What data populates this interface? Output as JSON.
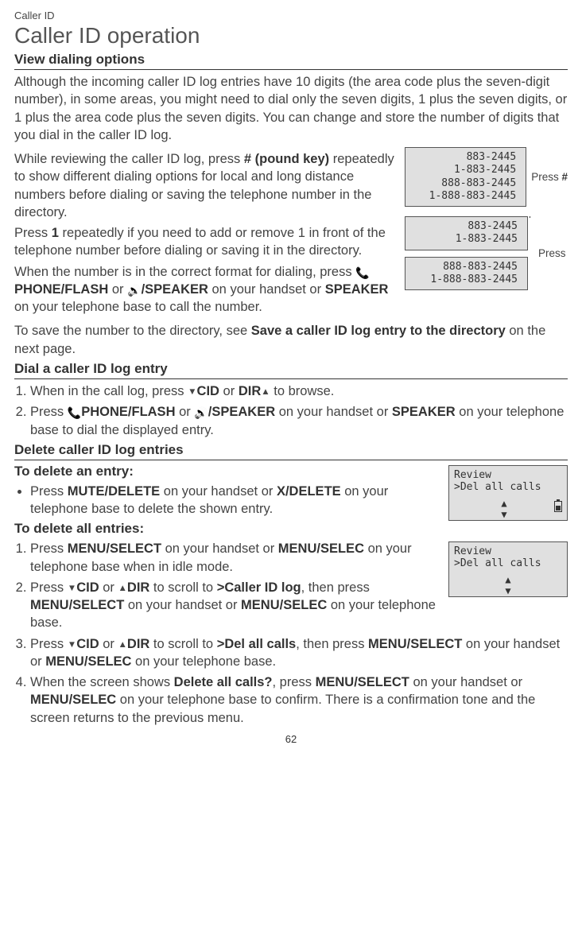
{
  "breadcrumb": "Caller ID",
  "title": "Caller ID operation",
  "section1": {
    "heading": "View dialing options",
    "p1a": "Although the incoming caller ID log entries have 10 digits (the area code plus the seven-digit number), in some areas, you might need to dial only the seven digits, 1 plus the seven digits, or 1 plus the area code plus the seven digits. You can change and store the number of digits that you dial in the caller ID log.",
    "p2a": "While reviewing the caller ID log, press ",
    "p2b": "# (pound key)",
    "p2c": " repeatedly to show different dialing options for local and long distance numbers before dialing or saving the telephone number in the directory.",
    "p3a": "Press ",
    "p3b": "1",
    "p3c": " repeatedly if you need to add or remove 1 in front of the telephone number before dialing or saving it in the directory.",
    "p4a": "When the number is in the correct format for dialing, press ",
    "p4b": "PHONE/",
    "p4b2": "FLASH",
    "p4c": " or ",
    "p4d": "/SPEAKER",
    "p4e": " on your handset or ",
    "p4f": "SPEAKER",
    "p4g": " on your telephone base to call the number.",
    "p5a": "To save the number to the directory, see ",
    "p5b": "Save a caller ID log entry to the directory",
    "p5c": " on the next page."
  },
  "fig": {
    "lcd1_lines": [
      "883-2445",
      "1-883-2445",
      "888-883-2445",
      "1-888-883-2445"
    ],
    "lcd2_lines": [
      "883-2445",
      "1-883-2445"
    ],
    "lcd3_lines": [
      "888-883-2445",
      "1-888-883-2445"
    ],
    "label_pound_a": "Press ",
    "label_pound_b": "#",
    "label_one_a": "Press ",
    "label_one_b": "1"
  },
  "section2": {
    "heading": "Dial a caller ID log entry",
    "s1a": "When in the call log, press ",
    "s1b": "CID",
    "s1c": " or ",
    "s1d": "DIR",
    "s1e": " to browse.",
    "s2a": "Press ",
    "s2b": "PHONE/",
    "s2b2": "FLASH",
    "s2c": " or ",
    "s2d": "/SPEAKER",
    "s2e": " on your handset or ",
    "s2f": "SPEAKER",
    "s2g": " on your telephone base to dial the displayed entry."
  },
  "section3": {
    "heading": "Delete caller ID log entries",
    "sub1": "To delete an entry:",
    "b1a": "Press ",
    "b1b": "MUTE",
    "b1c": "/DELETE",
    "b1d": " on your handset or ",
    "b1e": "X/DELETE",
    "b1f": " on your telephone base to delete the shown entry.",
    "sub2": "To delete all entries:",
    "s1a": "Press ",
    "s1b": "MENU/",
    "s1b2": "SELECT",
    "s1c": " on your handset or ",
    "s1d": "MENU/",
    "s1d2": "SELEC",
    "s1e": " on your telephone base when in idle mode.",
    "s2a": "Press ",
    "s2b": "CID",
    "s2c": " or ",
    "s2d": "DIR",
    "s2e": " to scroll to ",
    "s2f": ">Caller ID log",
    "s2g": ", then press ",
    "s2h": "MENU",
    "s2h2": "/SELECT",
    "s2i": " on your handset or ",
    "s2j": "MENU",
    "s2j2": "/SELEC",
    "s2k": " on your telephone base.",
    "s3a": "Press ",
    "s3b": "CID",
    "s3c": " or ",
    "s3d": "DIR",
    "s3e": " to scroll to ",
    "s3f": ">Del all calls",
    "s3g": ", then press ",
    "s3h": "MENU",
    "s3h2": "/SELECT",
    "s3i": " on your handset or ",
    "s3j": "MENU",
    "s3j2": "/SELEC",
    "s3k": " on your telephone base.",
    "s4a": "When the screen shows ",
    "s4b": "Delete all calls?",
    "s4c": ", press ",
    "s4d": "MENU",
    "s4d2": "/SELECT",
    "s4e": " on your handset or ",
    "s4f": "MENU",
    "s4f2": "/SELEC",
    "s4g": " on your telephone base to confirm. There is a confirmation tone and the screen returns to the previous menu."
  },
  "screen1": {
    "l1": "Review",
    "l2": ">Del all calls"
  },
  "screen2": {
    "l1": "Review",
    "l2": ">Del all calls"
  },
  "page_num": "62"
}
